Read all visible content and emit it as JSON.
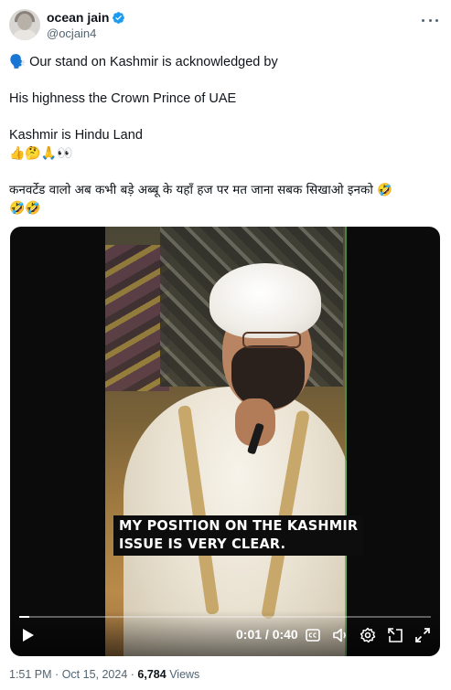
{
  "author": {
    "display_name": "ocean jain",
    "handle": "@ocjain4",
    "verified_color": "#1d9bf0"
  },
  "tweet": {
    "lines": [
      "🗣️ Our stand on Kashmir is acknowledged by",
      "His highness the Crown Prince of UAE",
      "Kashmir is Hindu Land",
      "👍🤔🙏👀",
      "कनवर्टेड वालो अब कभी बड़े अब्बू के यहाँ हज पर मत जाना सबक सिखाओ इनको 🤣",
      "🤣🤣"
    ]
  },
  "video": {
    "caption_lines": [
      "MY POSITION ON THE KASHMIR",
      "ISSUE IS VERY CLEAR."
    ],
    "time": "0:01 / 0:40",
    "progress": 0.025
  },
  "footer": {
    "time": "1:51 PM",
    "date": "Oct 15, 2024",
    "separator": "·",
    "views_count": "6,784",
    "views_label": "Views"
  }
}
